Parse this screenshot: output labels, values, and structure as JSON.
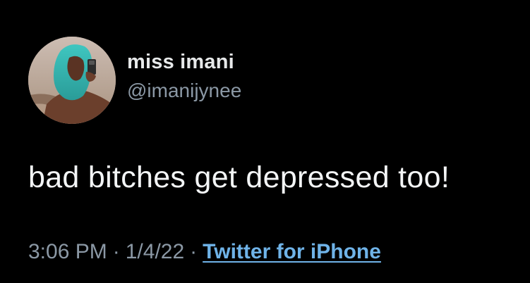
{
  "tweet": {
    "author": {
      "display_name": "miss imani",
      "handle": "@imanijynee"
    },
    "text": "bad bitches get depressed too!",
    "time": "3:06 PM",
    "separator": "·",
    "date": "1/4/22",
    "source": "Twitter for iPhone"
  },
  "colors": {
    "background": "#000000",
    "primary_text": "#e7e9ea",
    "secondary_text": "#8b98a5",
    "link": "#6fb3e8"
  }
}
